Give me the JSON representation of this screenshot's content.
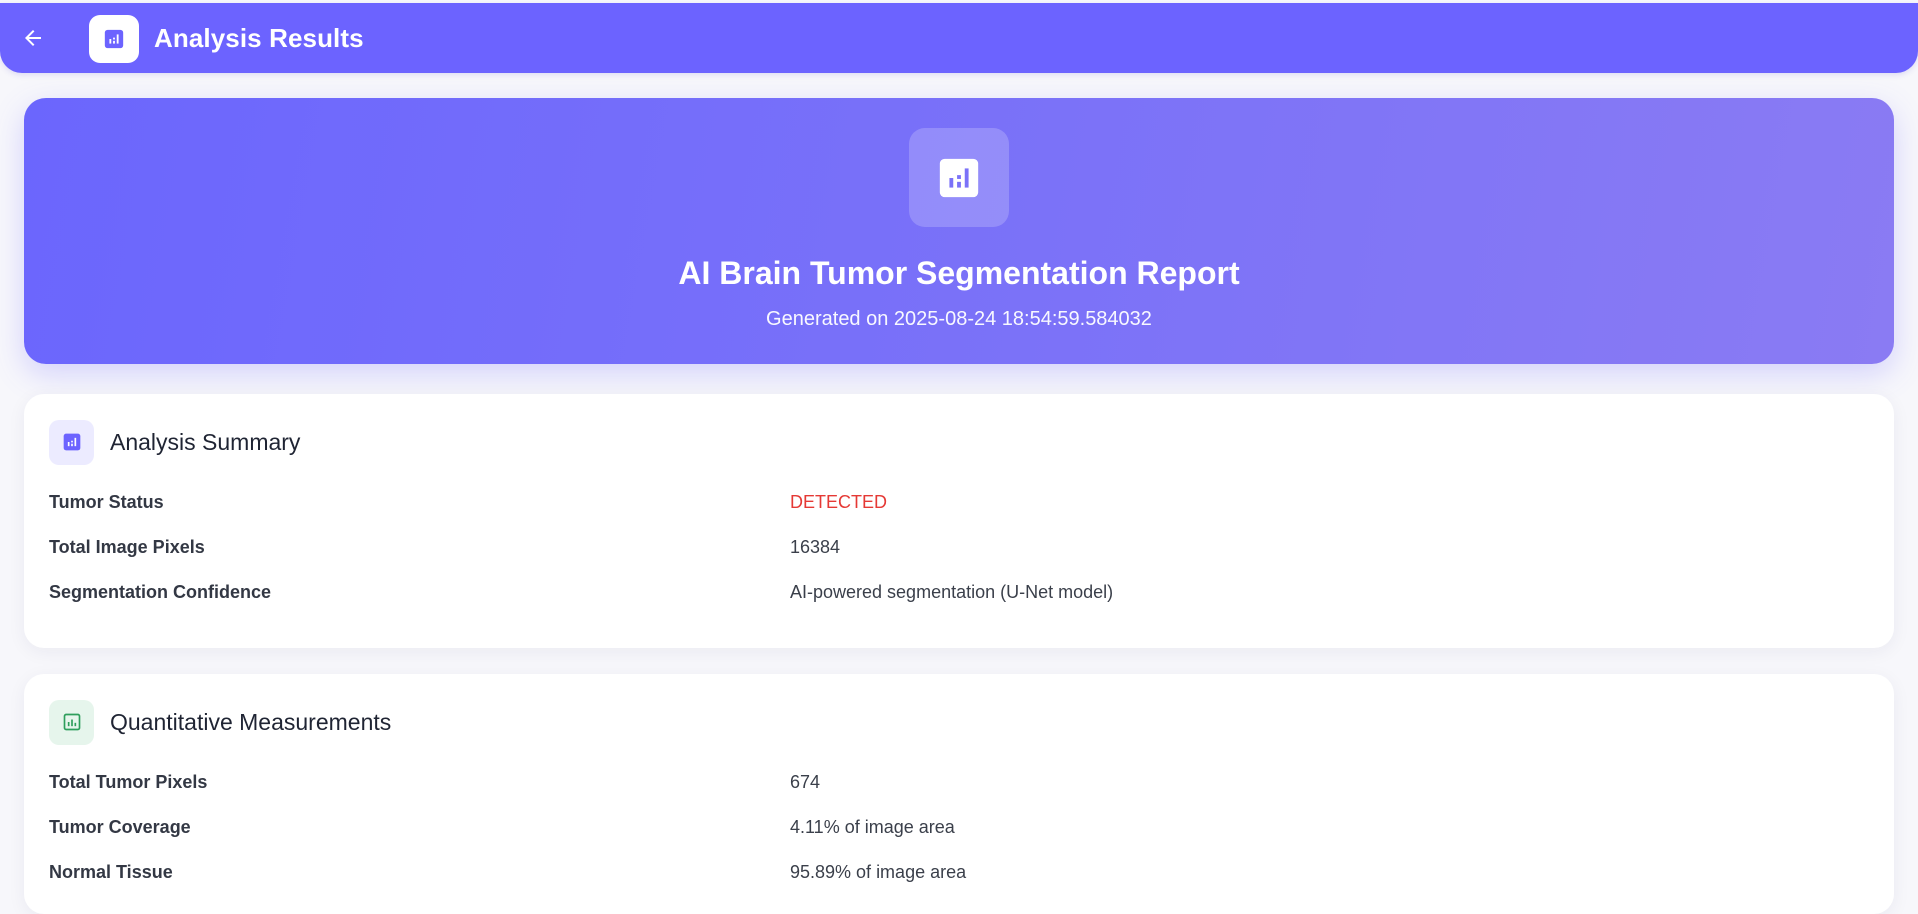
{
  "appbar": {
    "title": "Analysis Results",
    "back_icon": "arrow-left-icon",
    "logo_icon": "bar-chart-icon",
    "color": "#6c63ff"
  },
  "hero": {
    "icon": "bar-chart-icon",
    "title": "AI Brain Tumor Segmentation Report",
    "subtitle": "Generated on 2025-08-24 18:54:59.584032"
  },
  "summary": {
    "title": "Analysis Summary",
    "icon": "bar-chart-icon",
    "rows": [
      {
        "label": "Tumor Status",
        "value": "DETECTED",
        "value_color": "#e53935"
      },
      {
        "label": "Total Image Pixels",
        "value": "16384"
      },
      {
        "label": "Segmentation Confidence",
        "value": "AI-powered segmentation (U-Net model)"
      }
    ]
  },
  "quantitative": {
    "title": "Quantitative Measurements",
    "icon": "analytics-icon",
    "rows": [
      {
        "label": "Total Tumor Pixels",
        "value": "674"
      },
      {
        "label": "Tumor Coverage",
        "value": "4.11% of image area"
      },
      {
        "label": "Normal Tissue",
        "value": "95.89% of image area"
      }
    ]
  }
}
